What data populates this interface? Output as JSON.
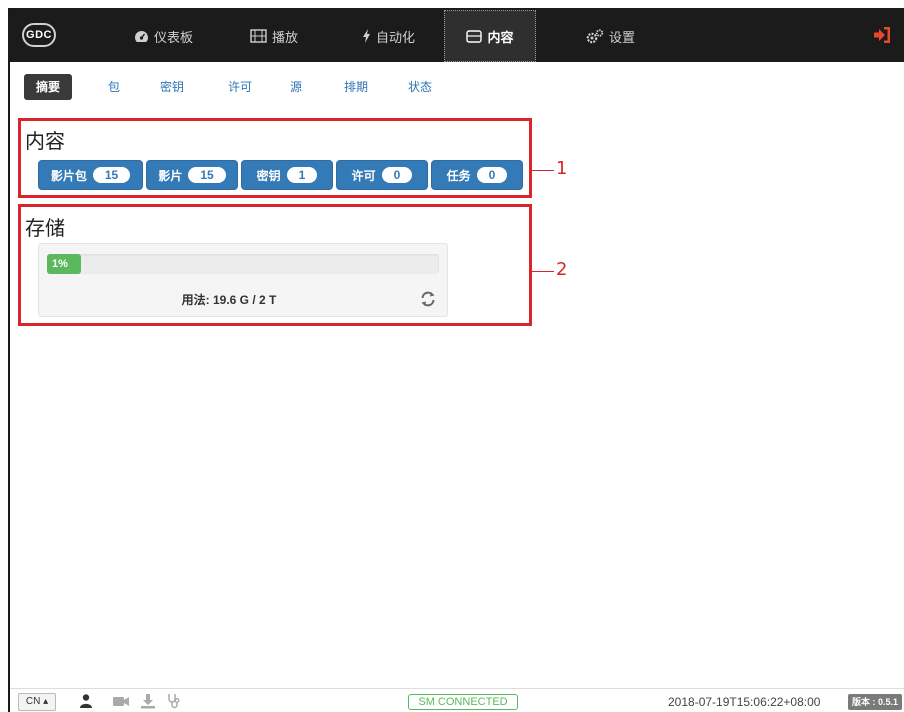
{
  "app": {
    "logo_text": "GDC"
  },
  "topnav": {
    "items": [
      {
        "label": "仪表板",
        "icon": "dashboard-icon"
      },
      {
        "label": "播放",
        "icon": "film-icon"
      },
      {
        "label": "自动化",
        "icon": "bolt-icon"
      },
      {
        "label": "内容",
        "icon": "content-icon",
        "active": true
      },
      {
        "label": "设置",
        "icon": "gears-icon"
      }
    ],
    "logout_icon": "logout-icon",
    "accent_color": "#e8472a"
  },
  "subnav": {
    "items": [
      {
        "label": "摘要",
        "active": true
      },
      {
        "label": "包"
      },
      {
        "label": "密钥"
      },
      {
        "label": "许可"
      },
      {
        "label": "源"
      },
      {
        "label": "排期"
      },
      {
        "label": "状态"
      }
    ]
  },
  "content_section": {
    "title": "内容",
    "counts": [
      {
        "label": "影片包",
        "count": "15"
      },
      {
        "label": "影片",
        "count": "15"
      },
      {
        "label": "密钥",
        "count": "1"
      },
      {
        "label": "许可",
        "count": "0"
      },
      {
        "label": "任务",
        "count": "0"
      }
    ],
    "callout": "1"
  },
  "storage_section": {
    "title": "存储",
    "progress_percent": 1,
    "progress_label": "1%",
    "usage_text": "用法: 19.6 G / 2 T",
    "refresh_icon": "refresh-icon",
    "callout": "2"
  },
  "footer": {
    "lang": "CN",
    "icons": [
      "user-icon",
      "camera-icon",
      "download-icon",
      "stethoscope-icon"
    ],
    "sm_status": "SM CONNECTED",
    "timestamp": "2018-07-19T15:06:22+08:00",
    "version": "版本 : 0.5.1"
  },
  "colors": {
    "primary": "#337ab7",
    "success": "#5cb85c",
    "annotation": "#d9262c",
    "nav_bg": "#1b1b1b"
  }
}
